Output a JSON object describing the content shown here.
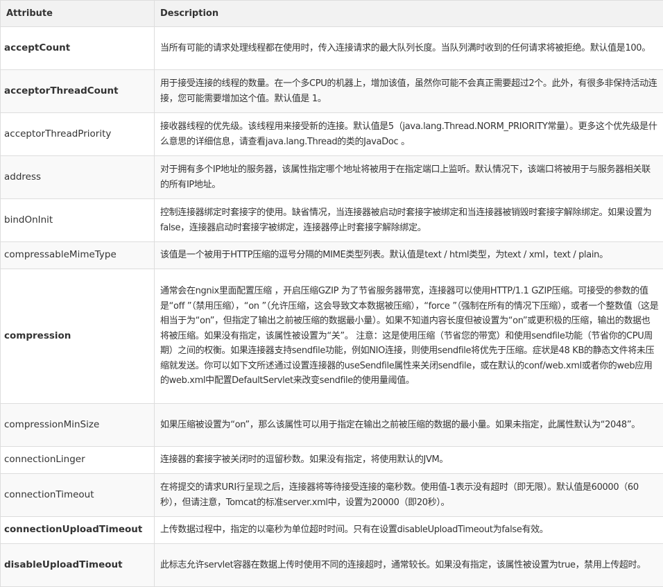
{
  "table": {
    "headers": {
      "attribute": "Attribute",
      "description": "Description"
    },
    "rows": [
      {
        "attribute": "acceptCount",
        "description": "当所有可能的请求处理线程都在使用时，传入连接请求的最大队列长度。当队列满时收到的任何请求将被拒绝。默认值是100。"
      },
      {
        "attribute": "acceptorThreadCount",
        "description": "用于接受连接的线程的数量。在一个多CPU的机器上，增加该值，虽然你可能不会真正需要超过2个。此外，有很多非保持活动连接，您可能需要增加这个值。默认值是 1。"
      },
      {
        "attribute": "acceptorThreadPriority",
        "description": "接收器线程的优先级。该线程用来接受新的连接。默认值是5（java.lang.Thread.NORM_PRIORITY常量）。更多这个优先级是什么意思的详细信息，请查看java.lang.Thread的类的JavaDoc 。"
      },
      {
        "attribute": "address",
        "description": "对于拥有多个IP地址的服务器，该属性指定哪个地址将被用于在指定端口上监听。默认情况下，该端口将被用于与服务器相关联的所有IP地址。"
      },
      {
        "attribute": "bindOnInit",
        "description": "控制连接器绑定时套接字的使用。缺省情况，当连接器被启动时套接字被绑定和当连接器被销毁时套接字解除绑定。如果设置为false，连接器启动时套接字被绑定，连接器停止时套接字解除绑定。"
      },
      {
        "attribute": "compressableMimeType",
        "description": "该值是一个被用于HTTP压缩的逗号分隔的MIME类型列表。默认值是text / html类型，为text / xml，text / plain。"
      },
      {
        "attribute": "compression",
        "description": "通常会在ngnix里面配置压缩 ，开启压缩GZIP 为了节省服务器带宽，连接器可以使用HTTP/1.1 GZIP压缩。可接受的参数的值是“off ”（禁用压缩），“on ”（允许压缩，这会导致文本数据被压缩），“force ”（强制在所有的情况下压缩），或者一个整数值（这是相当于为“on”，但指定了输出之前被压缩的数据最小量）。如果不知道内容长度但被设置为“on”或更积极的压缩，输出的数据也将被压缩。如果没有指定，该属性被设置为“关”。 注意：这是使用压缩（节省您的带宽）和使用sendfile功能（节省你的CPU周期）之间的权衡。如果连接器支持sendfile功能，例如NIO连接，则使用sendfile将优先于压缩。症状是48 KB的静态文件将未压缩就发送。你可以如下文所述通过设置连接器的useSendfile属性来关闭sendfile，或在默认的conf/web.xml或者你的web应用的web.xml中配置DefaultServlet来改变sendfile的使用量阈值。"
      },
      {
        "attribute": "compressionMinSize",
        "description": "如果压缩被设置为“on”，那么该属性可以用于指定在输出之前被压缩的数据的最小量。如果未指定，此属性默认为“2048”。"
      },
      {
        "attribute": "connectionLinger",
        "description": "连接器的套接字被关闭时的逗留秒数。如果没有指定，将使用默认的JVM。"
      },
      {
        "attribute": "connectionTimeout",
        "description": "在将提交的请求URI行呈现之后，连接器将等待接受连接的毫秒数。使用值-1表示没有超时（即无限）。默认值是60000（60秒），但请注意，Tomcat的标准server.xml中，设置为20000（即20秒）。"
      },
      {
        "attribute": "connectionUploadTimeout",
        "description": "上传数据过程中，指定的以毫秒为单位超时时间。只有在设置disableUploadTimeout为false有效。"
      },
      {
        "attribute": "disableUploadTimeout",
        "description": "此标志允许servlet容器在数据上传时使用不同的连接超时，通常较长。如果没有指定，该属性被设置为true，禁用上传超时。"
      }
    ]
  }
}
